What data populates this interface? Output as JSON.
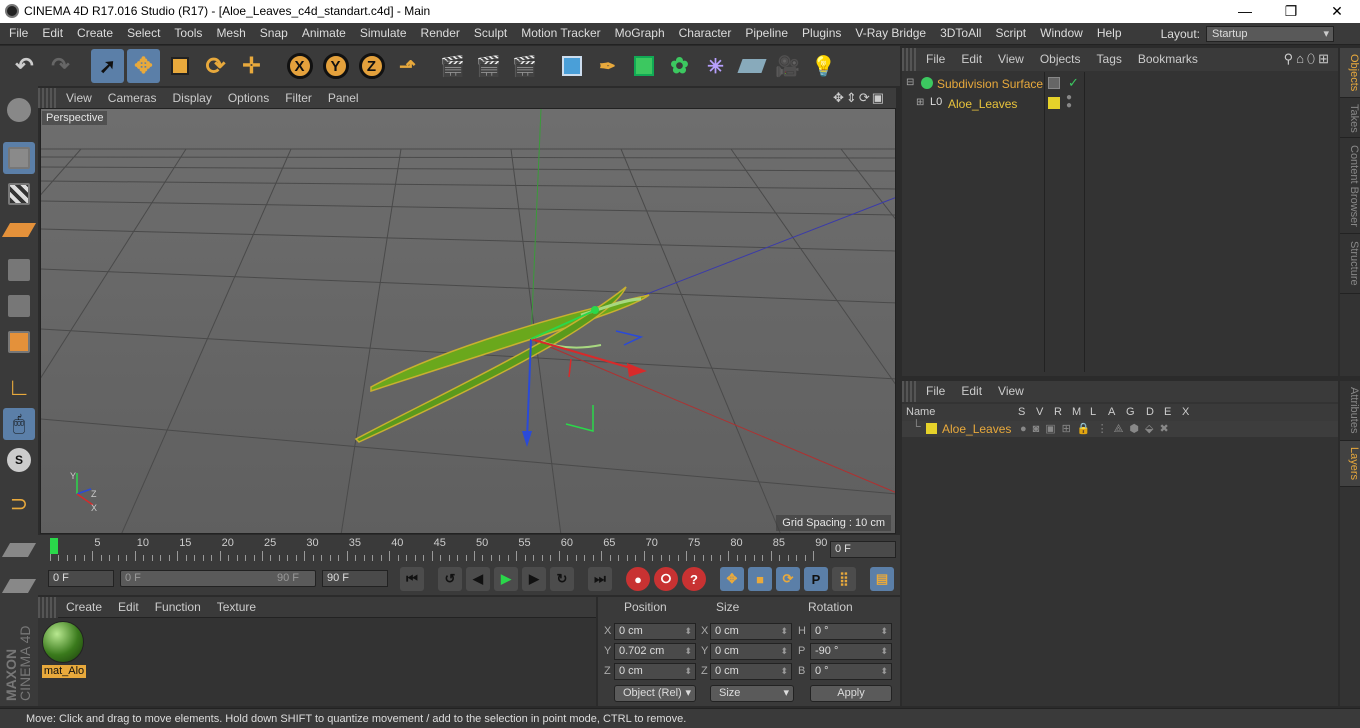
{
  "title_bar": {
    "title": "CINEMA 4D R17.016 Studio (R17) - [Aloe_Leaves_c4d_standart.c4d] - Main"
  },
  "menu": {
    "items": [
      "File",
      "Edit",
      "Create",
      "Select",
      "Tools",
      "Mesh",
      "Snap",
      "Animate",
      "Simulate",
      "Render",
      "Sculpt",
      "Motion Tracker",
      "MoGraph",
      "Character",
      "Pipeline",
      "Plugins",
      "V-Ray Bridge",
      "3DToAll",
      "Script",
      "Window",
      "Help"
    ],
    "layout_label": "Layout:",
    "layout_value": "Startup"
  },
  "viewport": {
    "menu": [
      "View",
      "Cameras",
      "Display",
      "Options",
      "Filter",
      "Panel"
    ],
    "camera_label": "Perspective",
    "grid_spacing": "Grid Spacing : 10 cm"
  },
  "timeline": {
    "ticks": [
      "0",
      "5",
      "10",
      "15",
      "20",
      "25",
      "30",
      "35",
      "40",
      "45",
      "50",
      "55",
      "60",
      "65",
      "70",
      "75",
      "80",
      "85",
      "90"
    ],
    "current_frame": "0 F"
  },
  "transport": {
    "start_field": "0 F",
    "range_start": "0 F",
    "range_end": "90 F",
    "end_field": "90 F"
  },
  "material_manager": {
    "menu": [
      "Create",
      "Edit",
      "Function",
      "Texture"
    ],
    "material_name": "mat_Alo"
  },
  "coordinates": {
    "headers": {
      "position": "Position",
      "size": "Size",
      "rotation": "Rotation"
    },
    "rows": [
      {
        "axis": "X",
        "pos": "0 cm",
        "saxis": "X",
        "size": "0 cm",
        "raxis": "H",
        "rot": "0 °"
      },
      {
        "axis": "Y",
        "pos": "0.702 cm",
        "saxis": "Y",
        "size": "0 cm",
        "raxis": "P",
        "rot": "-90 °"
      },
      {
        "axis": "Z",
        "pos": "0 cm",
        "saxis": "Z",
        "size": "0 cm",
        "raxis": "B",
        "rot": "0 °"
      }
    ],
    "mode_dropdown": "Object (Rel)",
    "size_dropdown": "Size",
    "apply": "Apply"
  },
  "object_manager": {
    "menu": [
      "File",
      "Edit",
      "View",
      "Objects",
      "Tags",
      "Bookmarks"
    ],
    "objects": [
      {
        "name": "Subdivision Surface",
        "color": "#e8a93c"
      },
      {
        "name": "Aloe_Leaves",
        "color": "#e8c33c"
      }
    ]
  },
  "layer_manager": {
    "menu": [
      "File",
      "Edit",
      "View"
    ],
    "columns": [
      "Name",
      "S",
      "V",
      "R",
      "M",
      "L",
      "A",
      "G",
      "D",
      "E",
      "X"
    ],
    "layers": [
      {
        "name": "Aloe_Leaves",
        "color": "#e6d22a"
      }
    ]
  },
  "side_tabs_top": [
    "Objects",
    "Takes",
    "Content Browser",
    "Structure"
  ],
  "side_tabs_bottom": [
    "Attributes",
    "Layers"
  ],
  "brand": {
    "line1": "MAXON",
    "line2": "CINEMA 4D"
  },
  "status": {
    "text": "Move: Click and drag to move elements. Hold down SHIFT to quantize movement / add to the selection in point mode, CTRL to remove."
  },
  "colors": {
    "accent": "#e8a93c",
    "selected": "#5b7fa8",
    "leaf": "#5a9a1c"
  }
}
